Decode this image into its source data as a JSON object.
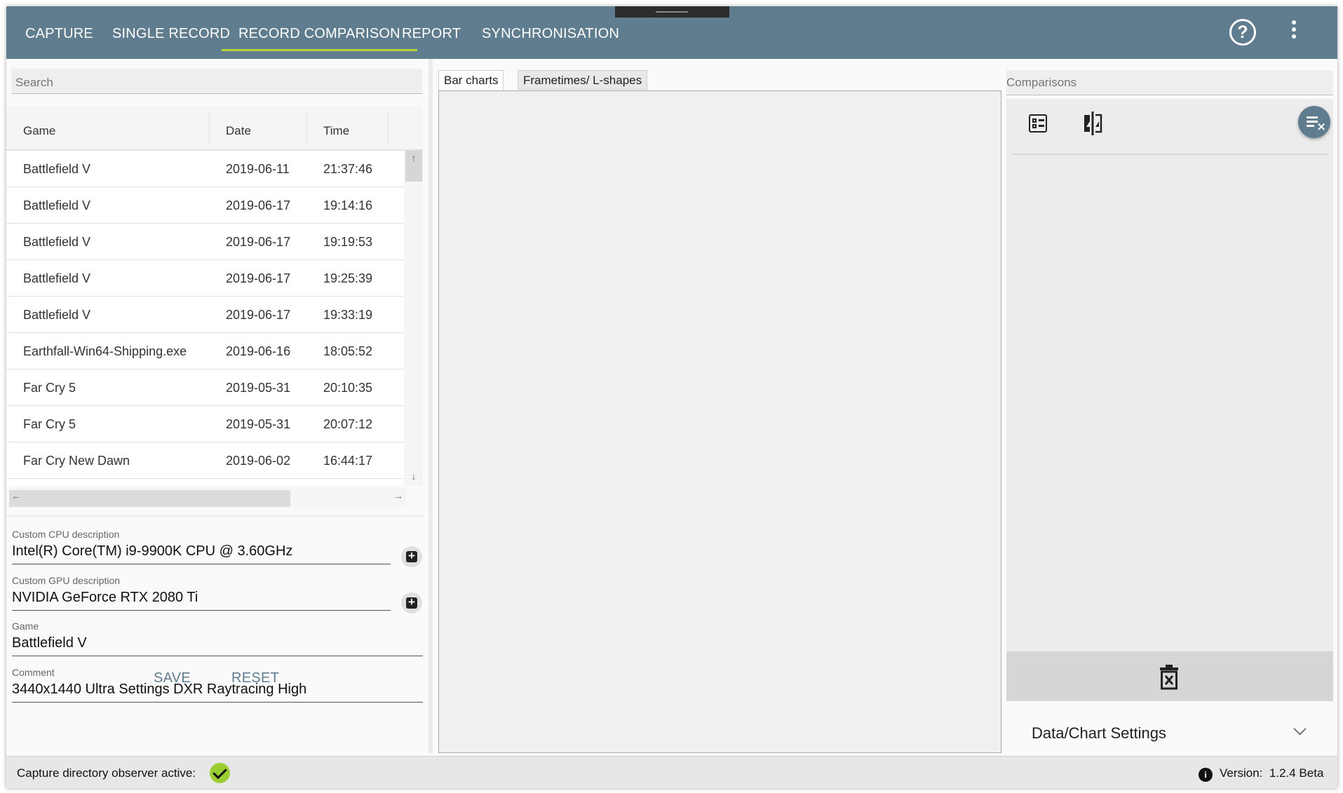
{
  "nav": {
    "tabs": [
      {
        "label": "CAPTURE"
      },
      {
        "label": "SINGLE RECORD"
      },
      {
        "label": "RECORD COMPARISON"
      },
      {
        "label": "REPORT"
      },
      {
        "label": "SYNCHRONISATION"
      }
    ],
    "active_tab": "RECORD COMPARISON",
    "help_icon": "help-circle-icon",
    "menu_icon": "more-vert-icon",
    "accent_color": "#b5d334",
    "bar_color": "#5f7d8e"
  },
  "search": {
    "placeholder": "Search"
  },
  "records": {
    "columns": [
      "Game",
      "Date",
      "Time"
    ],
    "rows": [
      {
        "game": "Battlefield V",
        "date": "2019-06-11",
        "time": "21:37:46"
      },
      {
        "game": "Battlefield V",
        "date": "2019-06-17",
        "time": "19:14:16"
      },
      {
        "game": "Battlefield V",
        "date": "2019-06-17",
        "time": "19:19:53"
      },
      {
        "game": "Battlefield V",
        "date": "2019-06-17",
        "time": "19:25:39"
      },
      {
        "game": "Battlefield V",
        "date": "2019-06-17",
        "time": "19:33:19"
      },
      {
        "game": "Earthfall-Win64-Shipping.exe",
        "date": "2019-06-16",
        "time": "18:05:52"
      },
      {
        "game": "Far Cry 5",
        "date": "2019-05-31",
        "time": "20:10:35"
      },
      {
        "game": "Far Cry 5",
        "date": "2019-05-31",
        "time": "20:07:12"
      },
      {
        "game": "Far Cry New Dawn",
        "date": "2019-06-02",
        "time": "16:44:17"
      }
    ]
  },
  "details": {
    "cpu": {
      "label": "Custom CPU description",
      "value": "Intel(R) Core(TM) i9-9900K CPU @ 3.60GHz"
    },
    "gpu": {
      "label": "Custom GPU description",
      "value": "NVIDIA GeForce RTX 2080 Ti"
    },
    "game": {
      "label": "Game",
      "value": "Battlefield V"
    },
    "comment": {
      "label": "Comment",
      "value": "3440x1440 Ultra Settings DXR Raytracing High"
    },
    "save_label": "SAVE",
    "reset_label": "RESET"
  },
  "chart": {
    "tabs": [
      {
        "label": "Bar charts"
      },
      {
        "label": "Frametimes/ L-shapes"
      }
    ],
    "active_tab": "Bar charts"
  },
  "comparisons": {
    "label": "Comparisons",
    "settings_label": "Data/Chart Settings",
    "icons": [
      "list-view-icon",
      "compare-icon",
      "clear-list-icon",
      "delete-icon",
      "chevron-down-icon"
    ]
  },
  "status": {
    "observer_text": "Capture directory observer active:",
    "observer_ok": true,
    "version_label": "Version:",
    "version_value": "1.2.4 Beta"
  }
}
